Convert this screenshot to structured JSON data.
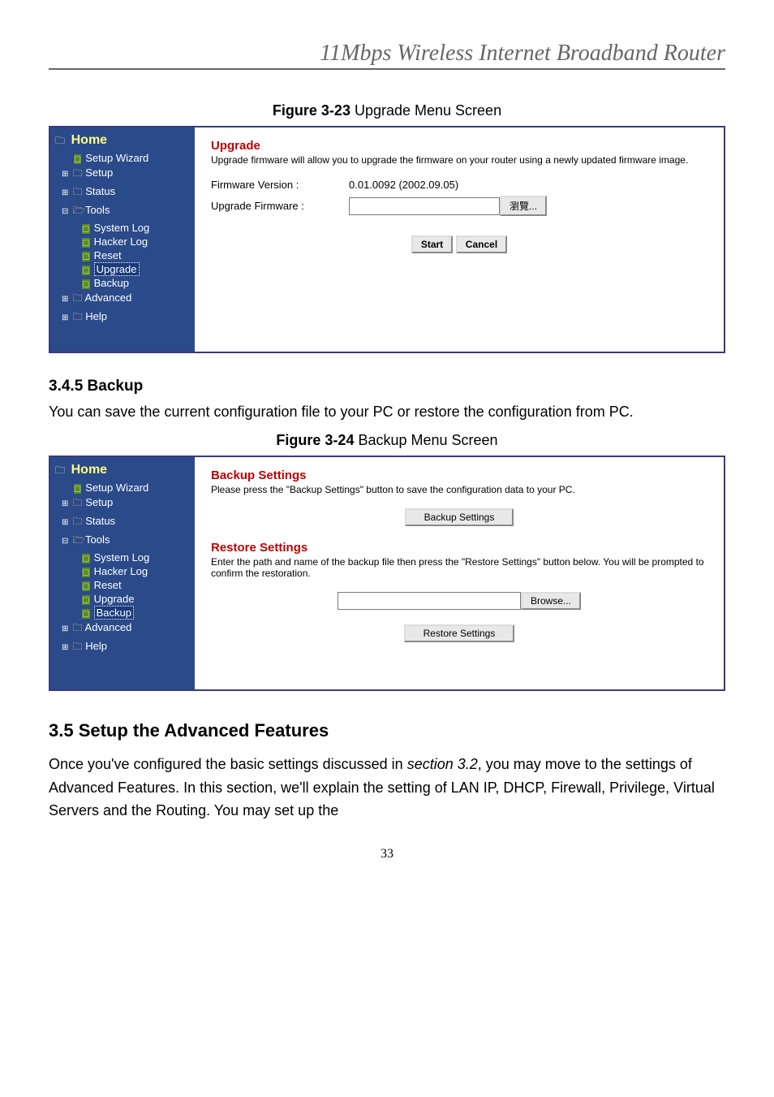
{
  "header": "11Mbps  Wireless  Internet  Broadband  Router",
  "fig23": {
    "label": "Figure 3-23",
    "title": "Upgrade Menu Screen"
  },
  "fig24": {
    "label": "Figure 3-24",
    "title": "Backup Menu Screen"
  },
  "nav": {
    "home": "Home",
    "setup_wizard": "Setup Wizard",
    "setup": "Setup",
    "status": "Status",
    "tools": "Tools",
    "system_log": "System Log",
    "hacker_log": "Hacker Log",
    "reset": "Reset",
    "upgrade": "Upgrade",
    "backup": "Backup",
    "advanced": "Advanced",
    "help": "Help"
  },
  "upgrade_panel": {
    "title": "Upgrade",
    "desc": "Upgrade firmware will allow you to upgrade the firmware on your router using a newly updated firmware image.",
    "fw_version_label": "Firmware Version :",
    "fw_version_value": "0.01.0092 (2002.09.05)",
    "upgrade_fw_label": "Upgrade Firmware :",
    "browse_btn": "瀏覽...",
    "start_btn": "Start",
    "cancel_btn": "Cancel"
  },
  "backup_section": {
    "heading": "3.4.5 Backup",
    "text": "You can save the current configuration file to your PC or restore the configuration from PC."
  },
  "backup_panel": {
    "backup_title": "Backup Settings",
    "backup_desc": "Please press the \"Backup Settings\" button to save the configuration data to your PC.",
    "backup_btn": "Backup Settings",
    "restore_title": "Restore Settings",
    "restore_desc": "Enter the path and name of the backup file then press the \"Restore Settings\" button below. You will be prompted to confirm the restoration.",
    "browse_btn": "Browse...",
    "restore_btn": "Restore Settings"
  },
  "advanced_section": {
    "heading": "3.5 Setup the Advanced Features",
    "text_prefix": "Once you've configured the basic settings discussed in ",
    "text_em": "section 3.2",
    "text_suffix": ", you may move to the settings of Advanced Features. In this section, we'll explain the setting of LAN IP, DHCP, Firewall, Privilege, Virtual Servers and the Routing. You may set up the"
  },
  "page_number": "33"
}
